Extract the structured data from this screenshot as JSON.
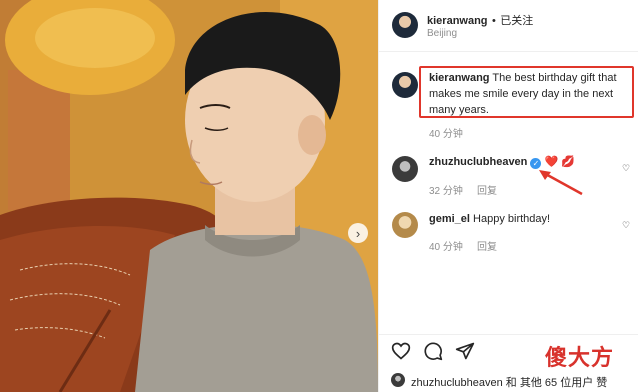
{
  "header": {
    "username": "kieranwang",
    "separator": "•",
    "follow_label": "已关注",
    "location": "Beijing"
  },
  "caption": {
    "username": "kieranwang",
    "text": "The best birthday gift that makes me smile every day in the next many years.",
    "time": "40 分钟"
  },
  "comments": [
    {
      "username": "zhuzhuclubheaven",
      "emoji": "❤️ 💋",
      "time": "32 分钟",
      "reply": "回复"
    },
    {
      "username": "gemi_el",
      "text": "Happy birthday!",
      "time": "40 分钟",
      "reply": "回复"
    }
  ],
  "likes": {
    "text": "zhuzhuclubheaven 和 其他 65 位用户 赞"
  },
  "icons": [
    "heart-icon",
    "comment-icon",
    "share-icon",
    "verified-icon",
    "chevron-right-icon"
  ],
  "watermark": "傻大方",
  "colors": {
    "highlight": "#e0362b",
    "verified": "#3897f0",
    "secondary_text": "#8e8e8e"
  }
}
